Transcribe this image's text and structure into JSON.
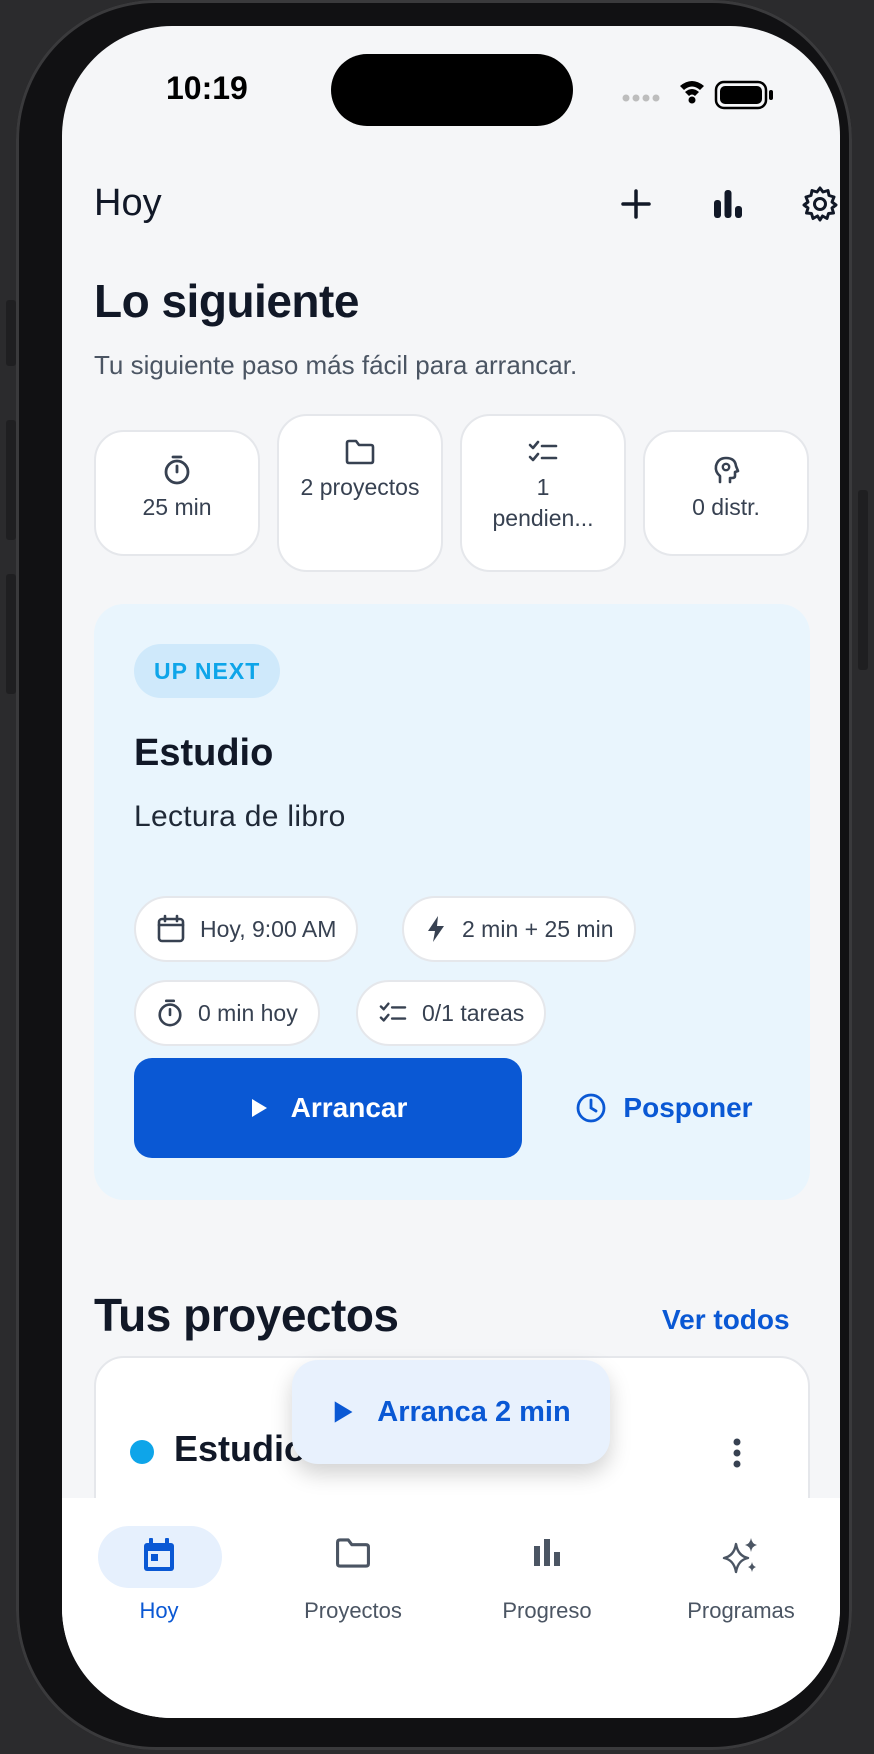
{
  "status_bar": {
    "time": "10:19"
  },
  "header": {
    "title": "Hoy"
  },
  "hero": {
    "title": "Lo siguiente",
    "subtitle": "Tu siguiente paso más fácil para arrancar."
  },
  "stats": [
    {
      "icon": "timer-icon",
      "label": "25 min"
    },
    {
      "icon": "folder-icon",
      "label": "2 proyectos"
    },
    {
      "icon": "checklist-icon",
      "label": "1 pendien..."
    },
    {
      "icon": "head-icon",
      "label": "0 distr."
    }
  ],
  "up_next": {
    "badge": "UP NEXT",
    "title": "Estudio",
    "subtitle": "Lectura de libro",
    "chips": {
      "date": "Hoy, 9:00 AM",
      "duration": "2 min + 25 min",
      "today": "0 min hoy",
      "tasks": "0/1 tareas"
    },
    "start_label": "Arrancar",
    "snooze_label": "Posponer"
  },
  "projects": {
    "title": "Tus proyectos",
    "see_all": "Ver todos",
    "items": [
      {
        "name": "Estudio",
        "color": "#0ea5e9"
      }
    ]
  },
  "fab": {
    "label": "Arranca 2 min"
  },
  "tabs": [
    {
      "label": "Hoy",
      "icon": "calendar-icon",
      "active": true
    },
    {
      "label": "Proyectos",
      "icon": "folder-icon",
      "active": false
    },
    {
      "label": "Progreso",
      "icon": "bar-chart-icon",
      "active": false
    },
    {
      "label": "Programas",
      "icon": "sparkles-icon",
      "active": false
    }
  ],
  "colors": {
    "accent": "#0a58d4",
    "sky": "#0ea5e9",
    "card_bg": "#e9f5fd",
    "text": "#111827"
  }
}
